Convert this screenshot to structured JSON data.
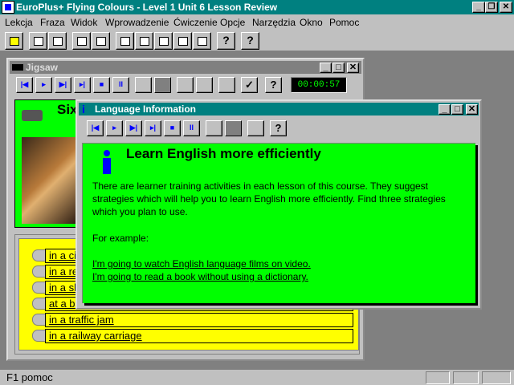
{
  "app": {
    "title": "EuroPlus+  Flying Colours - Level 1 Unit 6 Lesson Review",
    "caption_min": "_",
    "caption_restore": "❐",
    "caption_close": "✕"
  },
  "menu": [
    "Lekcja",
    "Fraza",
    "Widok",
    "Wprowadzenie",
    "Ćwiczenie",
    "Opcje",
    "Narzędzia",
    "Okno",
    "Pomoc"
  ],
  "toolbar": {
    "help_label": "?"
  },
  "jigsaw": {
    "title": "Jigsaw",
    "timer": "00:00:57",
    "check_label": "✓",
    "help_label": "?",
    "heading_partial": "Six",
    "items": [
      "in a ci",
      "in a re",
      "in a sh",
      "at a bu",
      "in a traffic jam",
      "in a railway carriage"
    ]
  },
  "info": {
    "title": "Language Information",
    "heading": "Learn English more efficiently",
    "paragraph": "There are learner training activities in each lesson of this course. They suggest strategies which will help you to learn English more efficiently. Find three strategies which you plan to use.",
    "for_example": "For example:",
    "examples": [
      "I'm going to watch English language films on video.",
      "I'm going to read a book without using a dictionary."
    ],
    "help_label": "?"
  },
  "statusbar": {
    "text": "F1 pomoc"
  },
  "colors": {
    "teal": "#008080",
    "green": "#00ff00",
    "yellow": "#ffff00",
    "grey": "#c0c0c0"
  }
}
